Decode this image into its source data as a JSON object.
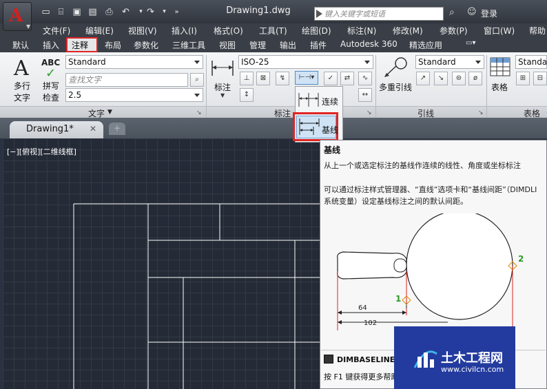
{
  "window": {
    "title": "Drawing1.dwg",
    "search_placeholder": "键入关键字或短语",
    "login": "登录"
  },
  "menu": [
    "文件(F)",
    "编辑(E)",
    "视图(V)",
    "插入(I)",
    "格式(O)",
    "工具(T)",
    "绘图(D)",
    "标注(N)",
    "修改(M)",
    "参数(P)",
    "窗口(W)",
    "帮助"
  ],
  "ribbon_tabs": [
    "默认",
    "插入",
    "注释",
    "布局",
    "参数化",
    "三维工具",
    "视图",
    "管理",
    "输出",
    "插件",
    "Autodesk 360",
    "精选应用"
  ],
  "active_tab": "注释",
  "text_panel": {
    "mtext_label_1": "多行",
    "mtext_label_2": "文字",
    "spell_label_1": "拼写",
    "spell_label_2": "检查",
    "abc": "ABC",
    "style_value": "Standard",
    "find_placeholder": "查找文字",
    "height_value": "2.5",
    "title": "文字"
  },
  "dim_panel": {
    "label": "标注",
    "style_value": "ISO-25",
    "title": "标注"
  },
  "leader_panel": {
    "label_1": "多重引线",
    "style_value": "Standard",
    "title": "引线"
  },
  "table_panel": {
    "label": "表格",
    "style_value": "Standard",
    "title": "表格"
  },
  "dropdown": {
    "continue_label": "连续",
    "baseline_label": "基线"
  },
  "doc_tab": {
    "label": "Drawing1*",
    "close": "✕"
  },
  "viewport_label": "[−][俯视][二维线框]",
  "tooltip": {
    "title": "基线",
    "description": "从上一个或选定标注的基线作连续的线性、角度或坐标标注",
    "note": "可以通过标注样式管理器、“直线”选项卡和“基线间距”（DIMDLI 系统变量）设定基线标注之间的默认间距。",
    "command": "DIMBASELINE",
    "help": "按 F1 键获得更多帮助",
    "dim_64": "64",
    "dim_102": "102",
    "point_1": "1",
    "point_2": "2"
  },
  "watermark": {
    "title": "土木工程网",
    "url": "www.civilcn.com"
  },
  "colors": {
    "highlight_red": "#e02424",
    "canvas_bg": "#252b36",
    "watermark_blue": "#233b9e"
  }
}
